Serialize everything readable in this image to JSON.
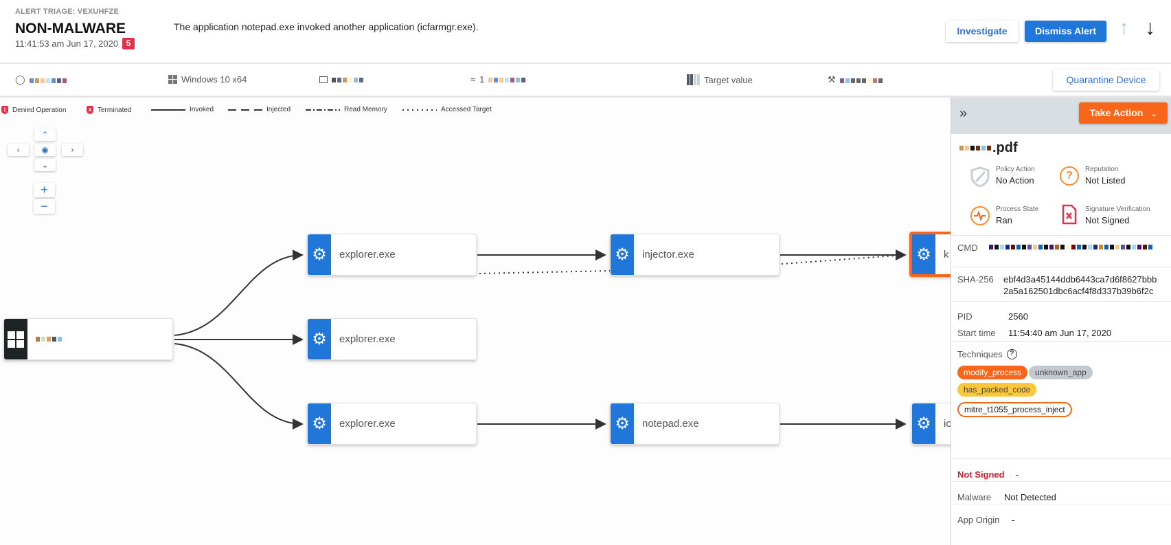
{
  "header": {
    "kicker": "ALERT TRIAGE: VEXUHFZE",
    "title": "NON-MALWARE",
    "timestamp": "11:41:53 am Jun 17, 2020",
    "severity": "5",
    "description": "The application notepad.exe invoked another application (icfarmgr.exe).",
    "investigate_label": "Investigate",
    "dismiss_label": "Dismiss Alert"
  },
  "infobar": {
    "os": "Windows 10 x64",
    "ip_prefix": "1",
    "target_value": "Target value",
    "quarantine_label": "Quarantine Device"
  },
  "legend": {
    "denied": "Denied Operation",
    "terminated": "Terminated",
    "invoked": "Invoked",
    "injected": "Injected",
    "read_memory": "Read Memory",
    "accessed_target": "Accessed Target"
  },
  "graph": {
    "nodes": {
      "explorer1": "explorer.exe",
      "explorer2": "explorer.exe",
      "explorer3": "explorer.exe",
      "injector": "injector.exe",
      "notepad": "notepad.exe",
      "k_node": "k",
      "ic_node": "ic"
    }
  },
  "panel": {
    "take_action": "Take Action",
    "filename_ext": ".pdf",
    "policy_action": {
      "label": "Policy Action",
      "value": "No Action"
    },
    "reputation": {
      "label": "Reputation",
      "value": "Not Listed"
    },
    "process_state": {
      "label": "Process State",
      "value": "Ran"
    },
    "signature": {
      "label": "Signature Verification",
      "value": "Not Signed"
    },
    "cmd_label": "CMD",
    "sha_label": "SHA-256",
    "sha_line1": "ebf4d3a45144ddb6443ca7d6f8627bbb",
    "sha_line2": "2a5a162501dbc6acf4f8d337b39b6f2c",
    "pid_label": "PID",
    "pid": "2560",
    "start_label": "Start time",
    "start": "11:54:40 am Jun 17, 2020",
    "techniques_label": "Techniques",
    "techniques": [
      "modify_process",
      "unknown_app",
      "has_packed_code",
      "mitre_t1055_process_inject"
    ],
    "not_signed_label": "Not Signed",
    "not_signed_value": "-",
    "malware_label": "Malware",
    "malware_value": "Not Detected",
    "origin_label": "App Origin",
    "origin_value": "-"
  },
  "colors": {
    "accent": "#2176d9",
    "orange": "#fa6619",
    "red": "#e0324b",
    "yellow": "#fdc838",
    "gray_chip": "#c3c9ce"
  }
}
